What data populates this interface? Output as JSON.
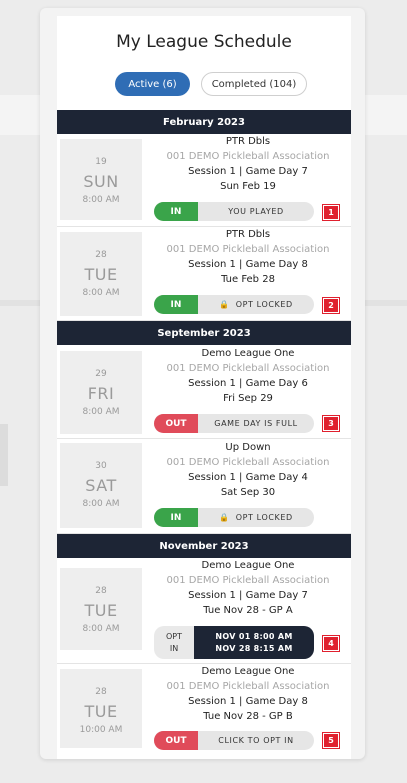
{
  "title": "My League Schedule",
  "tabs": {
    "active": "Active (6)",
    "completed": "Completed (104)"
  },
  "months": [
    "February 2023",
    "September 2023",
    "November 2023"
  ],
  "games": [
    {
      "num": "19",
      "dow": "SUN",
      "time": "8:00 AM",
      "league": "PTR Dbls",
      "assoc": "001 DEMO Pickleball Association",
      "session": "Session 1 | Game Day 7",
      "date": "Sun Feb 19",
      "status": "IN",
      "action": "YOU PLAYED",
      "badge": "1"
    },
    {
      "num": "28",
      "dow": "TUE",
      "time": "8:00 AM",
      "league": "PTR Dbls",
      "assoc": "001 DEMO Pickleball Association",
      "session": "Session 1 | Game Day 8",
      "date": "Tue Feb 28",
      "status": "IN",
      "action": "OPT LOCKED",
      "badge": "2"
    },
    {
      "num": "29",
      "dow": "FRI",
      "time": "8:00 AM",
      "league": "Demo League One",
      "assoc": "001 DEMO Pickleball Association",
      "session": "Session 1 | Game Day 6",
      "date": "Fri Sep 29",
      "status": "OUT",
      "action": "GAME DAY IS FULL",
      "badge": "3"
    },
    {
      "num": "30",
      "dow": "SAT",
      "time": "8:00 AM",
      "league": "Up Down",
      "assoc": "001 DEMO Pickleball Association",
      "session": "Session 1 | Game Day 4",
      "date": "Sat Sep 30",
      "status": "IN",
      "action": "OPT LOCKED",
      "badge": ""
    },
    {
      "num": "28",
      "dow": "TUE",
      "time": "8:00 AM",
      "league": "Demo League One",
      "assoc": "001 DEMO Pickleball Association",
      "session": "Session 1 | Game Day 7",
      "date": "Tue Nov 28 - GP A",
      "opt_line1": "OPT",
      "opt_line2": "IN",
      "window_open": "NOV 01 8:00 AM",
      "window_close": "NOV 28 8:15 AM",
      "badge": "4"
    },
    {
      "num": "28",
      "dow": "TUE",
      "time": "10:00 AM",
      "league": "Demo League One",
      "assoc": "001 DEMO Pickleball Association",
      "session": "Session 1 | Game Day 8",
      "date": "Tue Nov 28 - GP B",
      "status": "OUT",
      "action": "CLICK TO OPT IN",
      "badge": "5"
    }
  ],
  "icons": {
    "lock": "lock-icon"
  },
  "colors": {
    "in": "#3aa44a",
    "out": "#e04b5a",
    "tab_active": "#2f6db5",
    "header": "#1d2535",
    "badge": "#e0202e"
  }
}
